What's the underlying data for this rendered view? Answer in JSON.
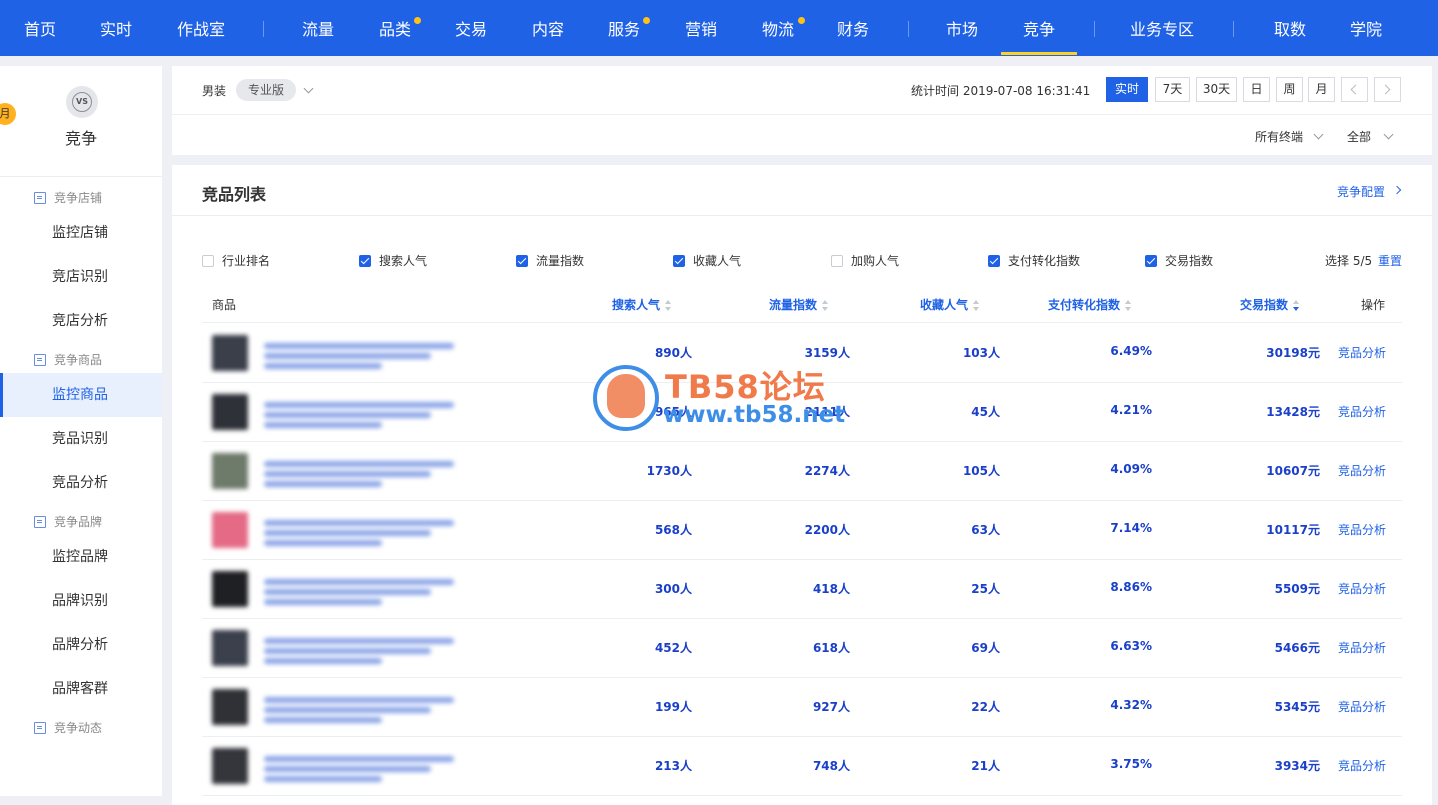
{
  "topnav": {
    "items": [
      {
        "label": "首页",
        "dot": false
      },
      {
        "label": "实时",
        "dot": false
      },
      {
        "label": "作战室",
        "dot": false
      },
      {
        "label": "流量",
        "dot": false
      },
      {
        "label": "品类",
        "dot": true
      },
      {
        "label": "交易",
        "dot": false
      },
      {
        "label": "内容",
        "dot": false
      },
      {
        "label": "服务",
        "dot": true
      },
      {
        "label": "营销",
        "dot": false
      },
      {
        "label": "物流",
        "dot": true
      },
      {
        "label": "财务",
        "dot": false
      },
      {
        "label": "市场",
        "dot": false
      },
      {
        "label": "竞争",
        "dot": false,
        "active": true
      },
      {
        "label": "业务专区",
        "dot": false
      },
      {
        "label": "取数",
        "dot": false
      },
      {
        "label": "学院",
        "dot": false
      }
    ],
    "accent": "#2062e6",
    "dot_color": "#ffc21a"
  },
  "sidebar": {
    "title": "竞争",
    "badge": "月",
    "icon": "vs-icon",
    "groups": [
      {
        "label": "竞争店铺",
        "items": [
          "监控店铺",
          "竞店识别",
          "竞店分析"
        ]
      },
      {
        "label": "竞争商品",
        "items": [
          "监控商品",
          "竞品识别",
          "竞品分析"
        ]
      },
      {
        "label": "竞争品牌",
        "items": [
          "监控品牌",
          "品牌识别",
          "品牌分析",
          "品牌客群"
        ]
      },
      {
        "label": "竞争动态",
        "items": []
      }
    ],
    "active_item": "监控商品"
  },
  "header": {
    "category": "男装",
    "edition": "专业版",
    "stat_time": "统计时间 2019-07-08 16:31:41",
    "time_buttons": [
      "实时",
      "7天",
      "30天",
      "日",
      "周",
      "月"
    ],
    "active_time": "实时",
    "filter_terminal": "所有终端",
    "filter_scope": "全部"
  },
  "product_list": {
    "title": "竞品列表",
    "config_link": "竞争配置",
    "metrics": [
      {
        "label": "行业排名",
        "checked": false
      },
      {
        "label": "搜索人气",
        "checked": true
      },
      {
        "label": "流量指数",
        "checked": true
      },
      {
        "label": "收藏人气",
        "checked": true
      },
      {
        "label": "加购人气",
        "checked": false
      },
      {
        "label": "支付转化指数",
        "checked": true
      },
      {
        "label": "交易指数",
        "checked": true
      }
    ],
    "selection": "选择 5/5",
    "reset": "重置",
    "columns": {
      "product": "商品",
      "search": "搜索人气",
      "traffic": "流量指数",
      "favorite": "收藏人气",
      "conversion": "支付转化指数",
      "trade": "交易指数",
      "action": "操作"
    },
    "rows": [
      {
        "search": "890人",
        "traffic": "3159人",
        "favorite": "103人",
        "conversion": "6.49%",
        "trade": "30198元",
        "action": "竞品分析",
        "thumb": "#3a3f4a"
      },
      {
        "search": "965人",
        "traffic": "2111人",
        "favorite": "45人",
        "conversion": "4.21%",
        "trade": "13428元",
        "action": "竞品分析",
        "thumb": "#2e3138"
      },
      {
        "search": "1730人",
        "traffic": "2274人",
        "favorite": "105人",
        "conversion": "4.09%",
        "trade": "10607元",
        "action": "竞品分析",
        "thumb": "#6e7a6a"
      },
      {
        "search": "568人",
        "traffic": "2200人",
        "favorite": "63人",
        "conversion": "7.14%",
        "trade": "10117元",
        "action": "竞品分析",
        "thumb": "#e46a86"
      },
      {
        "search": "300人",
        "traffic": "418人",
        "favorite": "25人",
        "conversion": "8.86%",
        "trade": "5509元",
        "action": "竞品分析",
        "thumb": "#1f2024"
      },
      {
        "search": "452人",
        "traffic": "618人",
        "favorite": "69人",
        "conversion": "6.63%",
        "trade": "5466元",
        "action": "竞品分析",
        "thumb": "#3b404c"
      },
      {
        "search": "199人",
        "traffic": "927人",
        "favorite": "22人",
        "conversion": "4.32%",
        "trade": "5345元",
        "action": "竞品分析",
        "thumb": "#2f3136"
      },
      {
        "search": "213人",
        "traffic": "748人",
        "favorite": "21人",
        "conversion": "3.75%",
        "trade": "3934元",
        "action": "竞品分析",
        "thumb": "#34363c"
      }
    ]
  },
  "watermark": {
    "line1": "TB58论坛",
    "line2": "www.tb58.net"
  }
}
